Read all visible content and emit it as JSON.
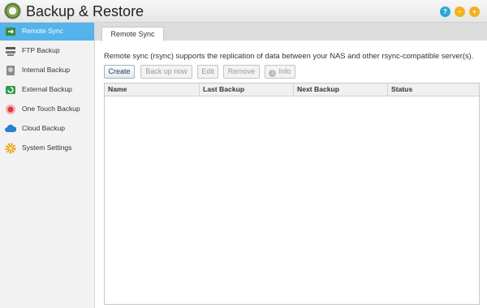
{
  "app": {
    "title": "Backup & Restore"
  },
  "window_controls": {
    "help": "?",
    "minimize": "–",
    "maximize": "+"
  },
  "sidebar": {
    "items": [
      {
        "label": "Remote Sync",
        "icon": "remote-sync-icon",
        "active": true
      },
      {
        "label": "FTP Backup",
        "icon": "ftp-icon"
      },
      {
        "label": "Internal Backup",
        "icon": "internal-backup-icon"
      },
      {
        "label": "External Backup",
        "icon": "external-backup-icon"
      },
      {
        "label": "One Touch Backup",
        "icon": "one-touch-icon"
      },
      {
        "label": "Cloud Backup",
        "icon": "cloud-icon"
      },
      {
        "label": "System Settings",
        "icon": "gear-icon"
      }
    ]
  },
  "tab": {
    "label": "Remote Sync"
  },
  "description": "Remote sync (rsync) supports the replication of data between your NAS and other rsync-compatible server(s).",
  "toolbar": {
    "create": "Create",
    "backup_now": "Back up now",
    "edit": "Edit",
    "remove": "Remove",
    "info": "Info"
  },
  "table": {
    "columns": [
      "Name",
      "Last Backup",
      "Next Backup",
      "Status"
    ],
    "rows": []
  },
  "colors": {
    "accent": "#53b3ea",
    "help": "#2ea6d6",
    "minimize": "#f2b21c"
  }
}
